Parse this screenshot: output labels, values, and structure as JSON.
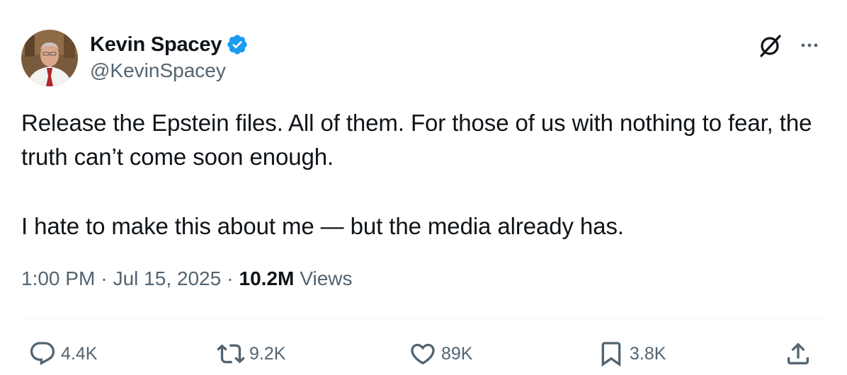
{
  "author": {
    "display_name": "Kevin Spacey",
    "handle": "@KevinSpacey",
    "verified": true
  },
  "tweet": {
    "paragraphs": [
      "Release the Epstein files. All of them. For those of us with nothing to fear, the truth can’t come soon enough.",
      "I hate to make this about me — but the media already has."
    ]
  },
  "meta": {
    "time": "1:00 PM",
    "separator": "·",
    "date": "Jul 15, 2025",
    "views_count": "10.2M",
    "views_label": "Views"
  },
  "actions": {
    "replies": "4.4K",
    "reposts": "9.2K",
    "likes": "89K",
    "bookmarks": "3.8K"
  },
  "colors": {
    "text_primary": "#0f1419",
    "text_secondary": "#536471",
    "verified_blue": "#1d9bf0",
    "divider": "#eff3f4"
  },
  "icons": {
    "verified": "verified-badge-icon",
    "grok": "grok-icon",
    "more": "more-horizontal-icon",
    "reply": "reply-icon",
    "repost": "repost-icon",
    "like": "heart-icon",
    "bookmark": "bookmark-icon",
    "share": "share-icon"
  }
}
